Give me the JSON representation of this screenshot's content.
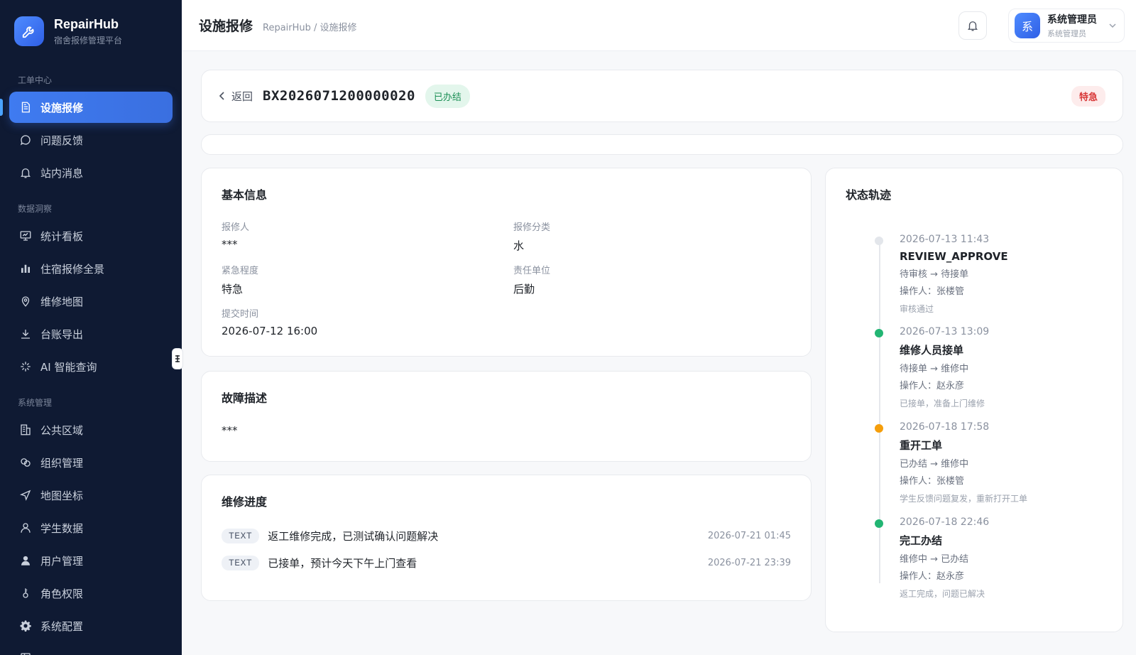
{
  "brand": {
    "name": "RepairHub",
    "subtitle": "宿舍报修管理平台"
  },
  "sidebar": {
    "groups": [
      {
        "label": "工单中心",
        "items": [
          "设施报修",
          "问题反馈",
          "站内消息"
        ]
      },
      {
        "label": "数据洞察",
        "items": [
          "统计看板",
          "住宿报修全景",
          "维修地图",
          "台账导出",
          "AI 智能查询"
        ]
      },
      {
        "label": "系统管理",
        "items": [
          "公共区域",
          "组织管理",
          "地图坐标",
          "学生数据",
          "用户管理",
          "角色权限",
          "系统配置"
        ]
      }
    ],
    "active_item": "设施报修"
  },
  "header": {
    "title": "设施报修",
    "breadcrumb": "RepairHub / 设施报修",
    "user": {
      "avatar_char": "系",
      "name": "系统管理员",
      "role": "系统管理员"
    }
  },
  "order": {
    "back_label": "返回",
    "number": "BX2026071200000020",
    "status": "已办结",
    "urgency_badge": "特急"
  },
  "basic_info": {
    "title": "基本信息",
    "fields": [
      {
        "label": "报修人",
        "value": "***"
      },
      {
        "label": "报修分类",
        "value": "水"
      },
      {
        "label": "紧急程度",
        "value": "特急"
      },
      {
        "label": "责任单位",
        "value": "后勤"
      },
      {
        "label": "提交时间",
        "value": "2026-07-12 16:00"
      }
    ]
  },
  "fault": {
    "title": "故障描述",
    "text": "***"
  },
  "progress": {
    "title": "维修进度",
    "items": [
      {
        "tag": "TEXT",
        "text": "返工维修完成，已测试确认问题解决",
        "time": "2026-07-21 01:45"
      },
      {
        "tag": "TEXT",
        "text": "已接单，预计今天下午上门查看",
        "time": "2026-07-21 23:39"
      }
    ]
  },
  "timeline": {
    "title": "状态轨迹",
    "items": [
      {
        "time": "2026-07-13 11:43",
        "title": "REVIEW_APPROVE",
        "transition": "待审核 → 待接单",
        "operator": "操作人：张楼管",
        "remark": "审核通过",
        "dot_color": "#e3e6eb"
      },
      {
        "time": "2026-07-13 13:09",
        "title": "维修人员接单",
        "transition": "待接单 → 维修中",
        "operator": "操作人：赵永彦",
        "remark": "已接单，准备上门维修",
        "dot_color": "#22b573"
      },
      {
        "time": "2026-07-18 17:58",
        "title": "重开工单",
        "transition": "已办结 → 维修中",
        "operator": "操作人：张楼管",
        "remark": "学生反馈问题复发，重新打开工单",
        "dot_color": "#f59e0b"
      },
      {
        "time": "2026-07-18 22:46",
        "title": "完工办结",
        "transition": "维修中 → 已办结",
        "operator": "操作人：赵永彦",
        "remark": "返工完成，问题已解决",
        "dot_color": "#22b573"
      }
    ]
  }
}
